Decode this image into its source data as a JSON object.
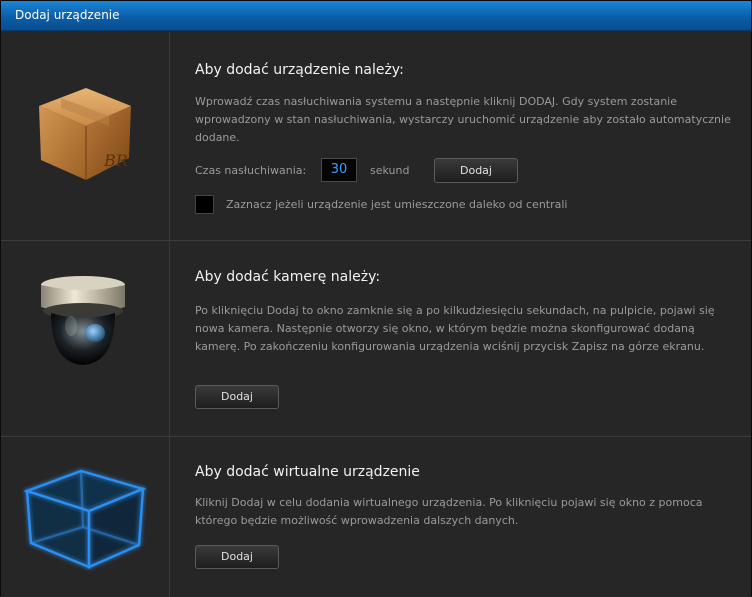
{
  "window": {
    "title": "Dodaj urządzenie"
  },
  "device": {
    "heading": "Aby dodać urządzenie należy:",
    "description": "Wprowadź czas nasłuchiwania systemu a następnie kliknij DODAJ. Gdy system zostanie wprowadzony w stan nasłuchiwania, wystarczy uruchomić urządzenie aby zostało automatycznie dodane.",
    "listen_label": "Czas nasłuchiwania:",
    "listen_value": "30",
    "unit_label": "sekund",
    "add_label": "Dodaj",
    "far_checkbox_label": "Zaznacz jeżeli urządzenie jest umieszczone daleko od centrali",
    "far_checked": false,
    "box_logo_text": "BR"
  },
  "camera": {
    "heading": "Aby dodać kamerę należy:",
    "description": "Po kliknięciu Dodaj to okno zamknie się a po kilkudziesięciu sekundach, na pulpicie, pojawi się nowa kamera. Następnie otworzy się okno, w którym będzie można skonfigurować dodaną kamerę. Po zakończeniu konfigurowania urządzenia wciśnij przycisk Zapisz na górze ekranu.",
    "add_label": "Dodaj"
  },
  "virtual": {
    "heading": "Aby dodać wirtualne urządzenie",
    "description": "Kliknij Dodaj w celu dodania wirtualnego urządzenia. Po kliknięciu pojawi się okno z pomoca którego będzie możliwość wprowadzenia dalszych danych.",
    "add_label": "Dodaj"
  },
  "colors": {
    "titlebar": "#0b5ea8",
    "background": "#262626",
    "input_text": "#3aa0ff"
  }
}
